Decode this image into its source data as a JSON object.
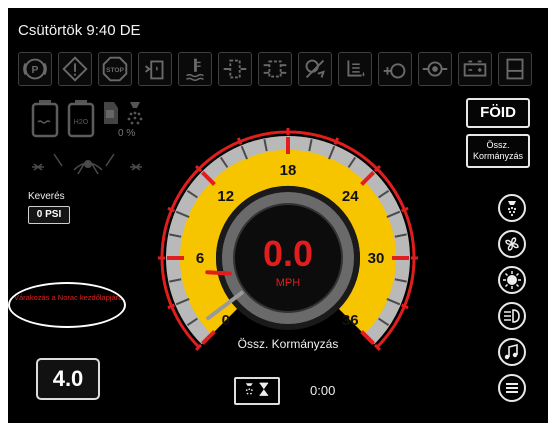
{
  "header": {
    "datetime": "Csütörtök 9:40 DE"
  },
  "warning_icons": [
    "parking-brake-icon",
    "warning-triangle-icon",
    "stop-icon",
    "fuel-water-icon",
    "coolant-temp-icon",
    "air-filter-icon",
    "hydraulic-filter-icon",
    "transmission-icon",
    "oil-level-icon",
    "engine-icon",
    "hydraulic-temp-icon",
    "battery-icon",
    "fuel-tank-icon"
  ],
  "left_panel": {
    "tank_labels": {
      "h2o": "H2O"
    },
    "percent": "0 %",
    "mix_label": "Keverés",
    "mix_value": "0 PSI",
    "wait_message": "Várakozás a Norac kezdőlapjára"
  },
  "right_buttons": {
    "foid": "FÖID",
    "ossz_line1": "Össz.",
    "ossz_line2": "Kormányzás"
  },
  "gauge": {
    "speed": "0.0",
    "unit": "MPH",
    "value": 0,
    "min": 0,
    "max": 36,
    "tick_labels": [
      "0",
      "6",
      "12",
      "18",
      "24",
      "30",
      "36"
    ],
    "bottom_label": "Össz. Kormányzás",
    "colors": {
      "face": "#f7c400",
      "accent": "#e01e1e",
      "needle": "#9a9a9a"
    }
  },
  "ground_speed": "4.0",
  "timer": "0:00",
  "side_icons": [
    "nozzle-icon",
    "fan-icon",
    "sun-light-icon",
    "headlight-icon",
    "music-icon",
    "menu-icon"
  ]
}
